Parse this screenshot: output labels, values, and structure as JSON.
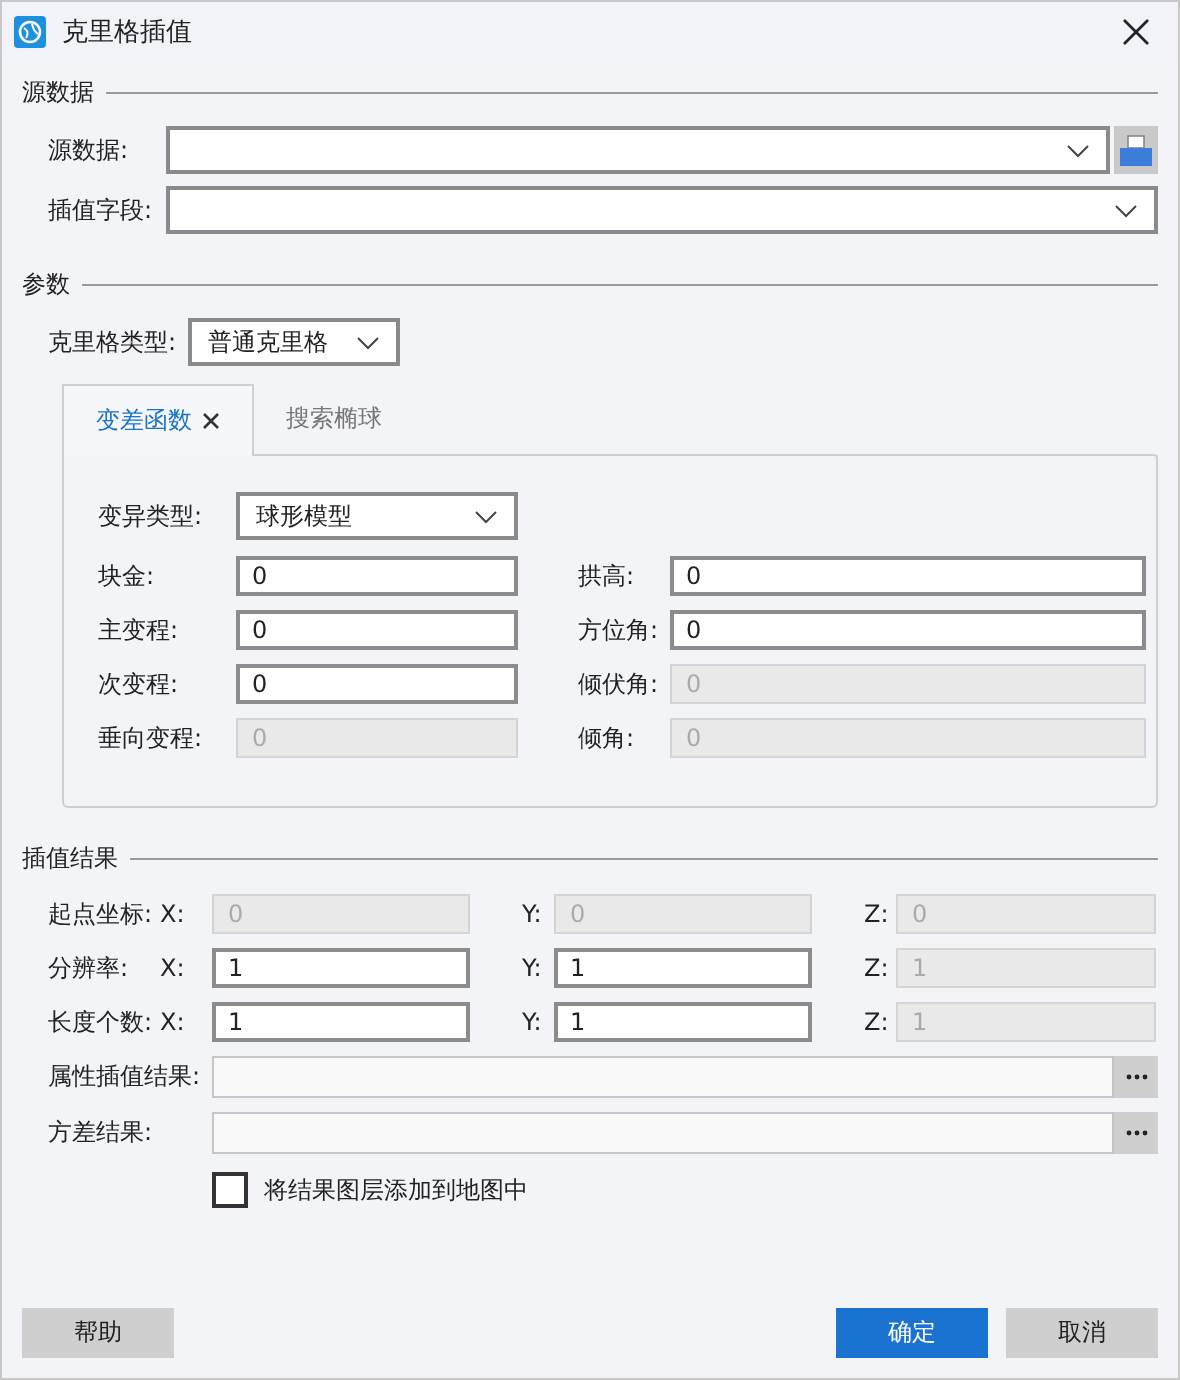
{
  "window": {
    "title": "克里格插值"
  },
  "source_section": {
    "heading": "源数据",
    "source_data": {
      "label": "源数据:"
    },
    "field": {
      "label": "插值字段:"
    }
  },
  "params_section": {
    "heading": "参数",
    "kriging_type": {
      "label": "克里格类型:",
      "value": "普通克里格"
    },
    "tabs": [
      {
        "label": "变差函数",
        "selected": true,
        "closable": true
      },
      {
        "label": "搜索椭球",
        "selected": false,
        "closable": false
      }
    ],
    "variogram_type": {
      "label": "变异类型:",
      "value": "球形模型"
    },
    "fields": [
      {
        "label": "块金:",
        "value": "0",
        "disabled": false
      },
      {
        "label": "拱高:",
        "value": "0",
        "disabled": false
      },
      {
        "label": "主变程:",
        "value": "0",
        "disabled": false
      },
      {
        "label": "方位角:",
        "value": "0",
        "disabled": false
      },
      {
        "label": "次变程:",
        "value": "0",
        "disabled": false
      },
      {
        "label": "倾伏角:",
        "value": "0",
        "disabled": true
      },
      {
        "label": "垂向变程:",
        "value": "0",
        "disabled": true
      },
      {
        "label": "倾角:",
        "value": "0",
        "disabled": true
      }
    ]
  },
  "results_section": {
    "heading": "插值结果",
    "grid_rows": [
      {
        "label": "起点坐标:",
        "axes": [
          {
            "label": "X:",
            "value": "0",
            "disabled": true
          },
          {
            "label": "Y:",
            "value": "0",
            "disabled": true
          },
          {
            "label": "Z:",
            "value": "0",
            "disabled": true
          }
        ]
      },
      {
        "label": "分辨率:",
        "axes": [
          {
            "label": "X:",
            "value": "1",
            "disabled": false
          },
          {
            "label": "Y:",
            "value": "1",
            "disabled": false
          },
          {
            "label": "Z:",
            "value": "1",
            "disabled": true
          }
        ]
      },
      {
        "label": "长度个数:",
        "axes": [
          {
            "label": "X:",
            "value": "1",
            "disabled": false
          },
          {
            "label": "Y:",
            "value": "1",
            "disabled": false
          },
          {
            "label": "Z:",
            "value": "1",
            "disabled": true
          }
        ]
      }
    ],
    "outputs": [
      {
        "label": "属性插值结果:"
      },
      {
        "label": "方差结果:"
      }
    ],
    "add_to_map": {
      "label": "将结果图层添加到地图中",
      "checked": false
    }
  },
  "buttons": [
    {
      "label": "帮助",
      "kind": "secondary"
    },
    {
      "label": "确定",
      "kind": "primary"
    },
    {
      "label": "取消",
      "kind": "secondary"
    }
  ]
}
